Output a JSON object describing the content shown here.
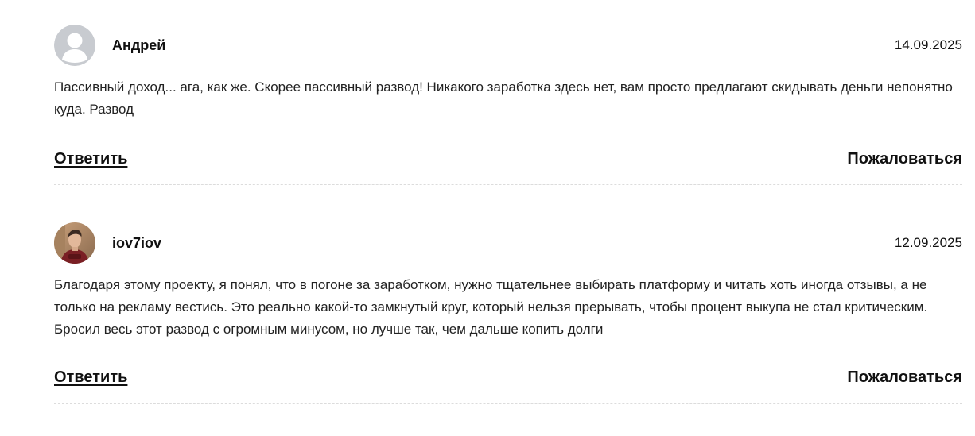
{
  "comments": [
    {
      "author": "Андрей",
      "date": "14.09.2025",
      "avatar_icon": "default-user-avatar-icon",
      "text": "Пассивный доход... ага, как же. Скорее пассивный развод! Никакого заработка здесь нет, вам просто предлагают скидывать деньги непонятно куда. Развод",
      "reply_label": "Ответить",
      "report_label": "Пожаловаться"
    },
    {
      "author": "iov7iov",
      "date": "12.09.2025",
      "avatar_icon": "user-photo-avatar",
      "text": "Благодаря этому проекту, я понял, что в погоне за заработком, нужно тщательнее выбирать платформу и читать хоть иногда отзывы, а не только на рекламу вестись. Это реально какой-то замкнутый круг, который нельзя прерывать, чтобы процент выкупа не стал критическим. Бросил весь этот развод с огромным минусом, но лучше так, чем дальше копить долги",
      "reply_label": "Ответить",
      "report_label": "Пожаловаться"
    }
  ],
  "colors": {
    "text": "#111111",
    "avatar_placeholder_bg": "#c8cbd0",
    "divider": "#dcdcdc"
  }
}
